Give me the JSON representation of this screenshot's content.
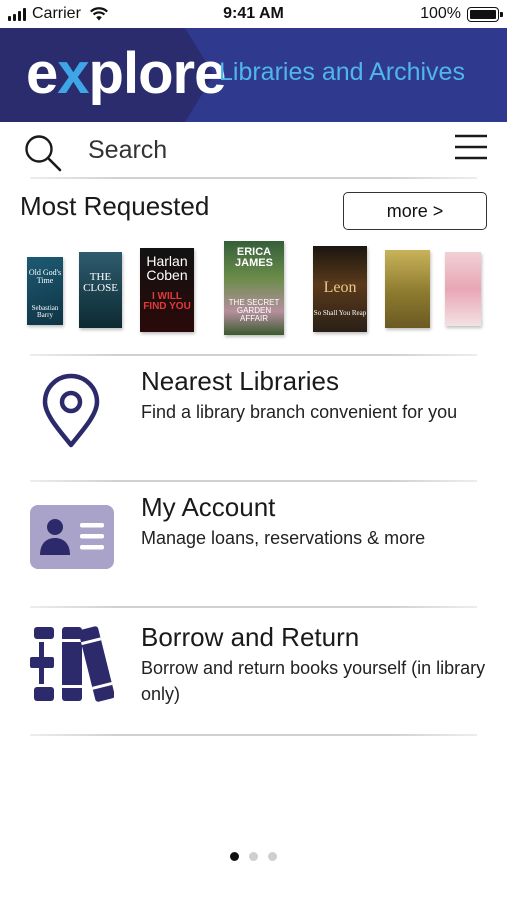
{
  "status_bar": {
    "carrier": "Carrier",
    "time": "9:41 AM",
    "battery": "100%"
  },
  "header": {
    "logo_ex": "e",
    "logo_x": "x",
    "logo_rest": "plore",
    "subtitle": "Libraries and Archives",
    "colors": {
      "banner": "#2f3a8e",
      "banner_dark": "#2a2c6d",
      "accent": "#4fb6ea"
    }
  },
  "search": {
    "placeholder": "Search",
    "value": ""
  },
  "most_requested": {
    "title": "Most Requested",
    "more_label": "more >",
    "books": [
      {
        "cover_text": "Old God's Time",
        "author": "Sebastian Barry"
      },
      {
        "cover_text": "THE CLOSE",
        "author": ""
      },
      {
        "cover_text": "I WILL FIND YOU",
        "author": "Harlan Coben"
      },
      {
        "cover_text": "THE SECRET GARDEN AFFAIR",
        "author": "ERICA JAMES"
      },
      {
        "cover_text": "So Shall You Reap",
        "author": "Leon"
      },
      {
        "cover_text": "",
        "author": ""
      },
      {
        "cover_text": "",
        "author": ""
      }
    ]
  },
  "sections": [
    {
      "id": "nearest-libraries",
      "title": "Nearest Libraries",
      "description": "Find a library branch convenient for you",
      "icon": "map-pin-icon"
    },
    {
      "id": "my-account",
      "title": "My Account",
      "description": "Manage loans, reservations & more",
      "icon": "id-card-icon"
    },
    {
      "id": "borrow-return",
      "title": "Borrow and Return",
      "description": "Borrow and return books yourself (in library only)",
      "icon": "books-plus-icon"
    }
  ],
  "pagination": {
    "total": 3,
    "active": 1
  },
  "icon_color": "#2c2a6b"
}
